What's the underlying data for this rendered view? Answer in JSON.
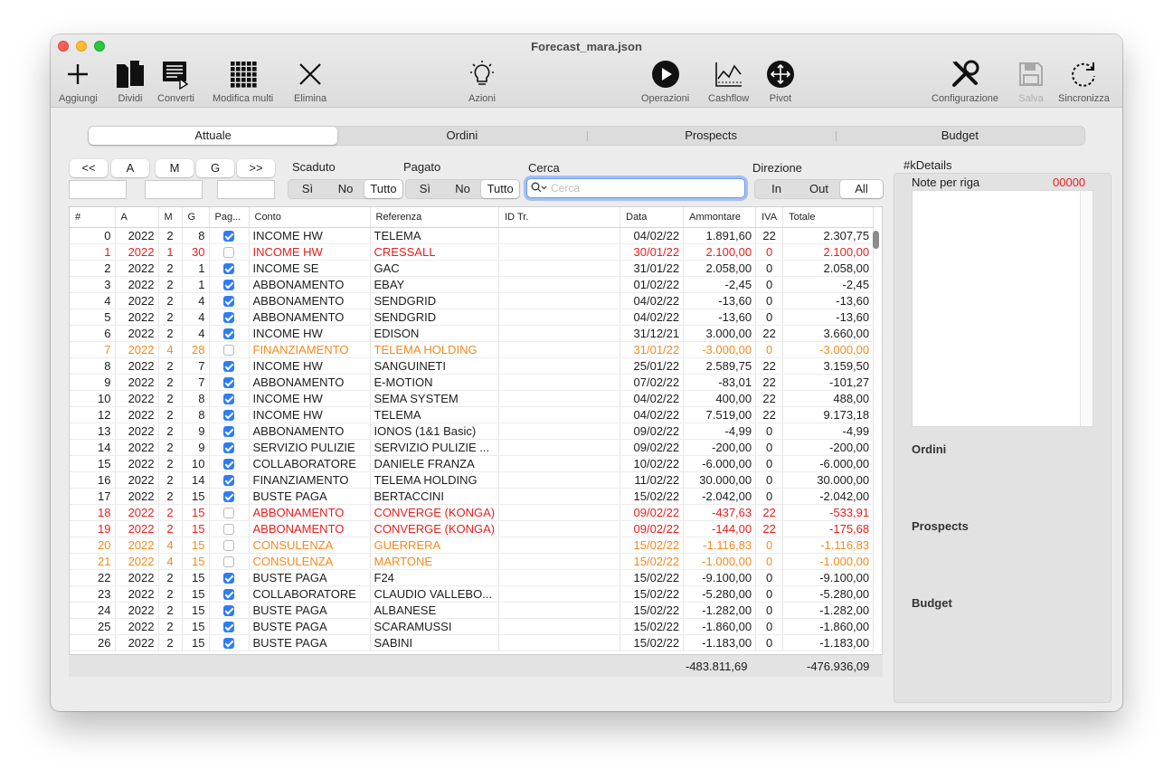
{
  "window": {
    "title": "Forecast_mara.json"
  },
  "toolbar": {
    "add": "Aggiungi",
    "split": "Dividi",
    "convert": "Converti",
    "multi_edit": "Modifica multi",
    "delete": "Elimina",
    "actions": "Azioni",
    "operations": "Operazioni",
    "cashflow": "Cashflow",
    "pivot": "Pivot",
    "config": "Configurazione",
    "save": "Salva",
    "sync": "Sincronizza"
  },
  "tabs": [
    "Attuale",
    "Ordini",
    "Prospects",
    "Budget"
  ],
  "nav": {
    "prev": "<<",
    "a": "A",
    "m": "M",
    "g": "G",
    "next": ">>"
  },
  "filters": {
    "scaduto_label": "Scaduto",
    "pagato_label": "Pagato",
    "cerca_label": "Cerca",
    "direzione_label": "Direzione",
    "si": "Sì",
    "no": "No",
    "tutto": "Tutto",
    "in": "In",
    "out": "Out",
    "all": "All",
    "search_placeholder": "Cerca"
  },
  "table": {
    "headers": [
      "#",
      "A",
      "M",
      "G",
      "Pag...",
      "Conto",
      "Referenza",
      "ID Tr.",
      "Data",
      "Ammontare",
      "IVA",
      "Totale"
    ],
    "rows": [
      {
        "n": "0",
        "a": "2022",
        "m": "2",
        "g": "8",
        "paid": true,
        "conto": "INCOME HW",
        "ref": "TELEMA",
        "id": "",
        "data": "04/02/22",
        "amm": "1.891,60",
        "iva": "22",
        "tot": "2.307,75",
        "color": ""
      },
      {
        "n": "1",
        "a": "2022",
        "m": "1",
        "g": "30",
        "paid": false,
        "conto": "INCOME HW",
        "ref": "CRESSALL",
        "id": "",
        "data": "30/01/22",
        "amm": "2.100,00",
        "iva": "0",
        "tot": "2.100,00",
        "color": "red"
      },
      {
        "n": "2",
        "a": "2022",
        "m": "2",
        "g": "1",
        "paid": true,
        "conto": "INCOME SE",
        "ref": "GAC",
        "id": "",
        "data": "31/01/22",
        "amm": "2.058,00",
        "iva": "0",
        "tot": "2.058,00",
        "color": ""
      },
      {
        "n": "3",
        "a": "2022",
        "m": "2",
        "g": "1",
        "paid": true,
        "conto": "ABBONAMENTO",
        "ref": "EBAY",
        "id": "",
        "data": "01/02/22",
        "amm": "-2,45",
        "iva": "0",
        "tot": "-2,45",
        "color": ""
      },
      {
        "n": "4",
        "a": "2022",
        "m": "2",
        "g": "4",
        "paid": true,
        "conto": "ABBONAMENTO",
        "ref": "SENDGRID",
        "id": "",
        "data": "04/02/22",
        "amm": "-13,60",
        "iva": "0",
        "tot": "-13,60",
        "color": ""
      },
      {
        "n": "5",
        "a": "2022",
        "m": "2",
        "g": "4",
        "paid": true,
        "conto": "ABBONAMENTO",
        "ref": "SENDGRID",
        "id": "",
        "data": "04/02/22",
        "amm": "-13,60",
        "iva": "0",
        "tot": "-13,60",
        "color": ""
      },
      {
        "n": "6",
        "a": "2022",
        "m": "2",
        "g": "4",
        "paid": true,
        "conto": "INCOME HW",
        "ref": "EDISON",
        "id": "",
        "data": "31/12/21",
        "amm": "3.000,00",
        "iva": "22",
        "tot": "3.660,00",
        "color": ""
      },
      {
        "n": "7",
        "a": "2022",
        "m": "4",
        "g": "28",
        "paid": false,
        "conto": "FINANZIAMENTO",
        "ref": "TELEMA HOLDING",
        "id": "",
        "data": "31/01/22",
        "amm": "-3.000,00",
        "iva": "0",
        "tot": "-3.000,00",
        "color": "orange"
      },
      {
        "n": "8",
        "a": "2022",
        "m": "2",
        "g": "7",
        "paid": true,
        "conto": "INCOME HW",
        "ref": "SANGUINETI",
        "id": "",
        "data": "25/01/22",
        "amm": "2.589,75",
        "iva": "22",
        "tot": "3.159,50",
        "color": ""
      },
      {
        "n": "9",
        "a": "2022",
        "m": "2",
        "g": "7",
        "paid": true,
        "conto": "ABBONAMENTO",
        "ref": "E-MOTION",
        "id": "",
        "data": "07/02/22",
        "amm": "-83,01",
        "iva": "22",
        "tot": "-101,27",
        "color": ""
      },
      {
        "n": "10",
        "a": "2022",
        "m": "2",
        "g": "8",
        "paid": true,
        "conto": "INCOME HW",
        "ref": "SEMA SYSTEM",
        "id": "",
        "data": "04/02/22",
        "amm": "400,00",
        "iva": "22",
        "tot": "488,00",
        "color": ""
      },
      {
        "n": "12",
        "a": "2022",
        "m": "2",
        "g": "8",
        "paid": true,
        "conto": "INCOME HW",
        "ref": "TELEMA",
        "id": "",
        "data": "04/02/22",
        "amm": "7.519,00",
        "iva": "22",
        "tot": "9.173,18",
        "color": ""
      },
      {
        "n": "13",
        "a": "2022",
        "m": "2",
        "g": "9",
        "paid": true,
        "conto": "ABBONAMENTO",
        "ref": "IONOS (1&1 Basic)",
        "id": "",
        "data": "09/02/22",
        "amm": "-4,99",
        "iva": "0",
        "tot": "-4,99",
        "color": ""
      },
      {
        "n": "14",
        "a": "2022",
        "m": "2",
        "g": "9",
        "paid": true,
        "conto": "SERVIZIO PULIZIE",
        "ref": "SERVIZIO PULIZIE ...",
        "id": "",
        "data": "09/02/22",
        "amm": "-200,00",
        "iva": "0",
        "tot": "-200,00",
        "color": ""
      },
      {
        "n": "15",
        "a": "2022",
        "m": "2",
        "g": "10",
        "paid": true,
        "conto": "COLLABORATORE",
        "ref": "DANIELE FRANZA",
        "id": "",
        "data": "10/02/22",
        "amm": "-6.000,00",
        "iva": "0",
        "tot": "-6.000,00",
        "color": ""
      },
      {
        "n": "16",
        "a": "2022",
        "m": "2",
        "g": "14",
        "paid": true,
        "conto": "FINANZIAMENTO",
        "ref": "TELEMA HOLDING",
        "id": "",
        "data": "11/02/22",
        "amm": "30.000,00",
        "iva": "0",
        "tot": "30.000,00",
        "color": ""
      },
      {
        "n": "17",
        "a": "2022",
        "m": "2",
        "g": "15",
        "paid": true,
        "conto": "BUSTE PAGA",
        "ref": "BERTACCINI",
        "id": "",
        "data": "15/02/22",
        "amm": "-2.042,00",
        "iva": "0",
        "tot": "-2.042,00",
        "color": ""
      },
      {
        "n": "18",
        "a": "2022",
        "m": "2",
        "g": "15",
        "paid": false,
        "conto": "ABBONAMENTO",
        "ref": "CONVERGE (KONGA)",
        "id": "",
        "data": "09/02/22",
        "amm": "-437,63",
        "iva": "22",
        "tot": "-533,91",
        "color": "red"
      },
      {
        "n": "19",
        "a": "2022",
        "m": "2",
        "g": "15",
        "paid": false,
        "conto": "ABBONAMENTO",
        "ref": "CONVERGE (KONGA)",
        "id": "",
        "data": "09/02/22",
        "amm": "-144,00",
        "iva": "22",
        "tot": "-175,68",
        "color": "red"
      },
      {
        "n": "20",
        "a": "2022",
        "m": "4",
        "g": "15",
        "paid": false,
        "conto": "CONSULENZA",
        "ref": "GUERRERA",
        "id": "",
        "data": "15/02/22",
        "amm": "-1.116,83",
        "iva": "0",
        "tot": "-1.116,83",
        "color": "orange"
      },
      {
        "n": "21",
        "a": "2022",
        "m": "4",
        "g": "15",
        "paid": false,
        "conto": "CONSULENZA",
        "ref": "MARTONE",
        "id": "",
        "data": "15/02/22",
        "amm": "-1.000,00",
        "iva": "0",
        "tot": "-1.000,00",
        "color": "orange"
      },
      {
        "n": "22",
        "a": "2022",
        "m": "2",
        "g": "15",
        "paid": true,
        "conto": "BUSTE PAGA",
        "ref": "F24",
        "id": "",
        "data": "15/02/22",
        "amm": "-9.100,00",
        "iva": "0",
        "tot": "-9.100,00",
        "color": ""
      },
      {
        "n": "23",
        "a": "2022",
        "m": "2",
        "g": "15",
        "paid": true,
        "conto": "COLLABORATORE",
        "ref": "CLAUDIO VALLEBO...",
        "id": "",
        "data": "15/02/22",
        "amm": "-5.280,00",
        "iva": "0",
        "tot": "-5.280,00",
        "color": ""
      },
      {
        "n": "24",
        "a": "2022",
        "m": "2",
        "g": "15",
        "paid": true,
        "conto": "BUSTE PAGA",
        "ref": "ALBANESE",
        "id": "",
        "data": "15/02/22",
        "amm": "-1.282,00",
        "iva": "0",
        "tot": "-1.282,00",
        "color": ""
      },
      {
        "n": "25",
        "a": "2022",
        "m": "2",
        "g": "15",
        "paid": true,
        "conto": "BUSTE PAGA",
        "ref": "SCARAMUSSI",
        "id": "",
        "data": "15/02/22",
        "amm": "-1.860,00",
        "iva": "0",
        "tot": "-1.860,00",
        "color": ""
      },
      {
        "n": "26",
        "a": "2022",
        "m": "2",
        "g": "15",
        "paid": true,
        "conto": "BUSTE PAGA",
        "ref": "SABINI",
        "id": "",
        "data": "15/02/22",
        "amm": "-1.183,00",
        "iva": "0",
        "tot": "-1.183,00",
        "color": ""
      }
    ],
    "totals": {
      "ammontare": "-483.811,69",
      "totale": "-476.936,09"
    }
  },
  "details": {
    "title": "#kDetails",
    "notes_label": "Note per riga",
    "notes_code": "00000",
    "ordini": "Ordini",
    "prospects": "Prospects",
    "budget": "Budget"
  },
  "colors": {
    "red": "#ea1c1c",
    "orange": "#f7891e",
    "accent": "#2e7cf6"
  }
}
